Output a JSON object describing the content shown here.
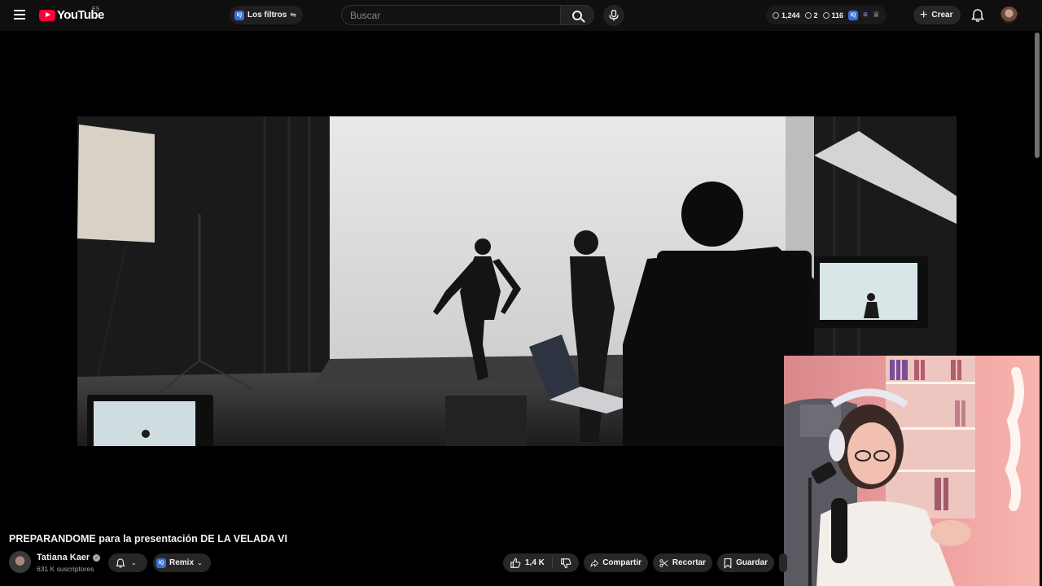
{
  "header": {
    "logo_text": "YouTube",
    "region": "ES",
    "filter_label": "Los filtros",
    "search_placeholder": "Buscar",
    "stats": {
      "views": "1,244",
      "count2": "2",
      "count3": "116"
    },
    "create_label": "Crear"
  },
  "video": {
    "title": "PREPARANDOME para la presentación DE LA VELADA VI"
  },
  "channel": {
    "name": "Tatiana Kaer",
    "subscribers": "631 K suscriptores"
  },
  "actions": {
    "remix_label": "Remix",
    "likes": "1,4 K",
    "share_label": "Compartir",
    "clip_label": "Recortar",
    "save_label": "Guardar"
  },
  "icons": [
    "menu-icon",
    "youtube-logo-icon",
    "extension-icon",
    "tune-icon",
    "search-icon",
    "mic-icon",
    "clock-icon",
    "eye-icon",
    "plus-icon",
    "bell-icon",
    "verified-icon",
    "thumbs-up-icon",
    "thumbs-down-icon",
    "share-icon",
    "scissors-icon",
    "bookmark-icon",
    "chevron-down-icon"
  ],
  "colors": {
    "brand": "#ff0033",
    "background": "#0f0f0f",
    "pill": "#272727",
    "extension": "#3b6fd8"
  }
}
